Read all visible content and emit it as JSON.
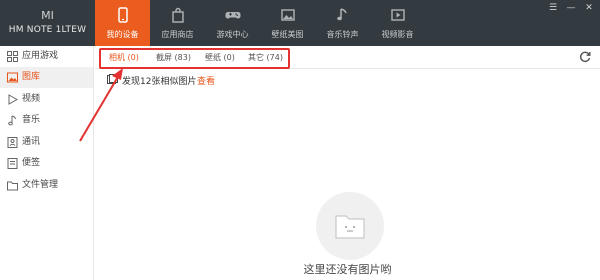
{
  "brand": {
    "logo_text": "MI",
    "device_name": "HM NOTE 1LTEW"
  },
  "tabs": [
    {
      "label": "我的设备",
      "icon": "phone-icon",
      "active": true
    },
    {
      "label": "应用商店",
      "icon": "bag-icon",
      "active": false
    },
    {
      "label": "游戏中心",
      "icon": "gamepad-icon",
      "active": false
    },
    {
      "label": "壁纸美图",
      "icon": "picture-icon",
      "active": false
    },
    {
      "label": "音乐铃声",
      "icon": "music-note-icon",
      "active": false
    },
    {
      "label": "视频影音",
      "icon": "video-icon",
      "active": false
    }
  ],
  "window_controls": {
    "menu": "☰",
    "minimize": "—",
    "close": "✕"
  },
  "sidebar": {
    "items": [
      {
        "label": "应用游戏",
        "icon": "apps-icon"
      },
      {
        "label": "图库",
        "icon": "gallery-icon",
        "active": true
      },
      {
        "label": "视频",
        "icon": "play-icon"
      },
      {
        "label": "音乐",
        "icon": "music-icon"
      },
      {
        "label": "通讯",
        "icon": "contacts-icon"
      },
      {
        "label": "便签",
        "icon": "note-icon"
      },
      {
        "label": "文件管理",
        "icon": "folder-icon"
      }
    ]
  },
  "filters": [
    {
      "label": "相机 (0)",
      "active": true
    },
    {
      "label": "截屏 (83)",
      "active": false
    },
    {
      "label": "壁纸 (0)",
      "active": false
    },
    {
      "label": "其它 (74)",
      "active": false
    }
  ],
  "notice": {
    "text": "发现12张相似图片",
    "link": "查看"
  },
  "empty_state": {
    "text": "这里还没有图片哟"
  },
  "colors": {
    "accent": "#ea5d1f",
    "topbar": "#333b40",
    "highlight": "#e3322f"
  }
}
